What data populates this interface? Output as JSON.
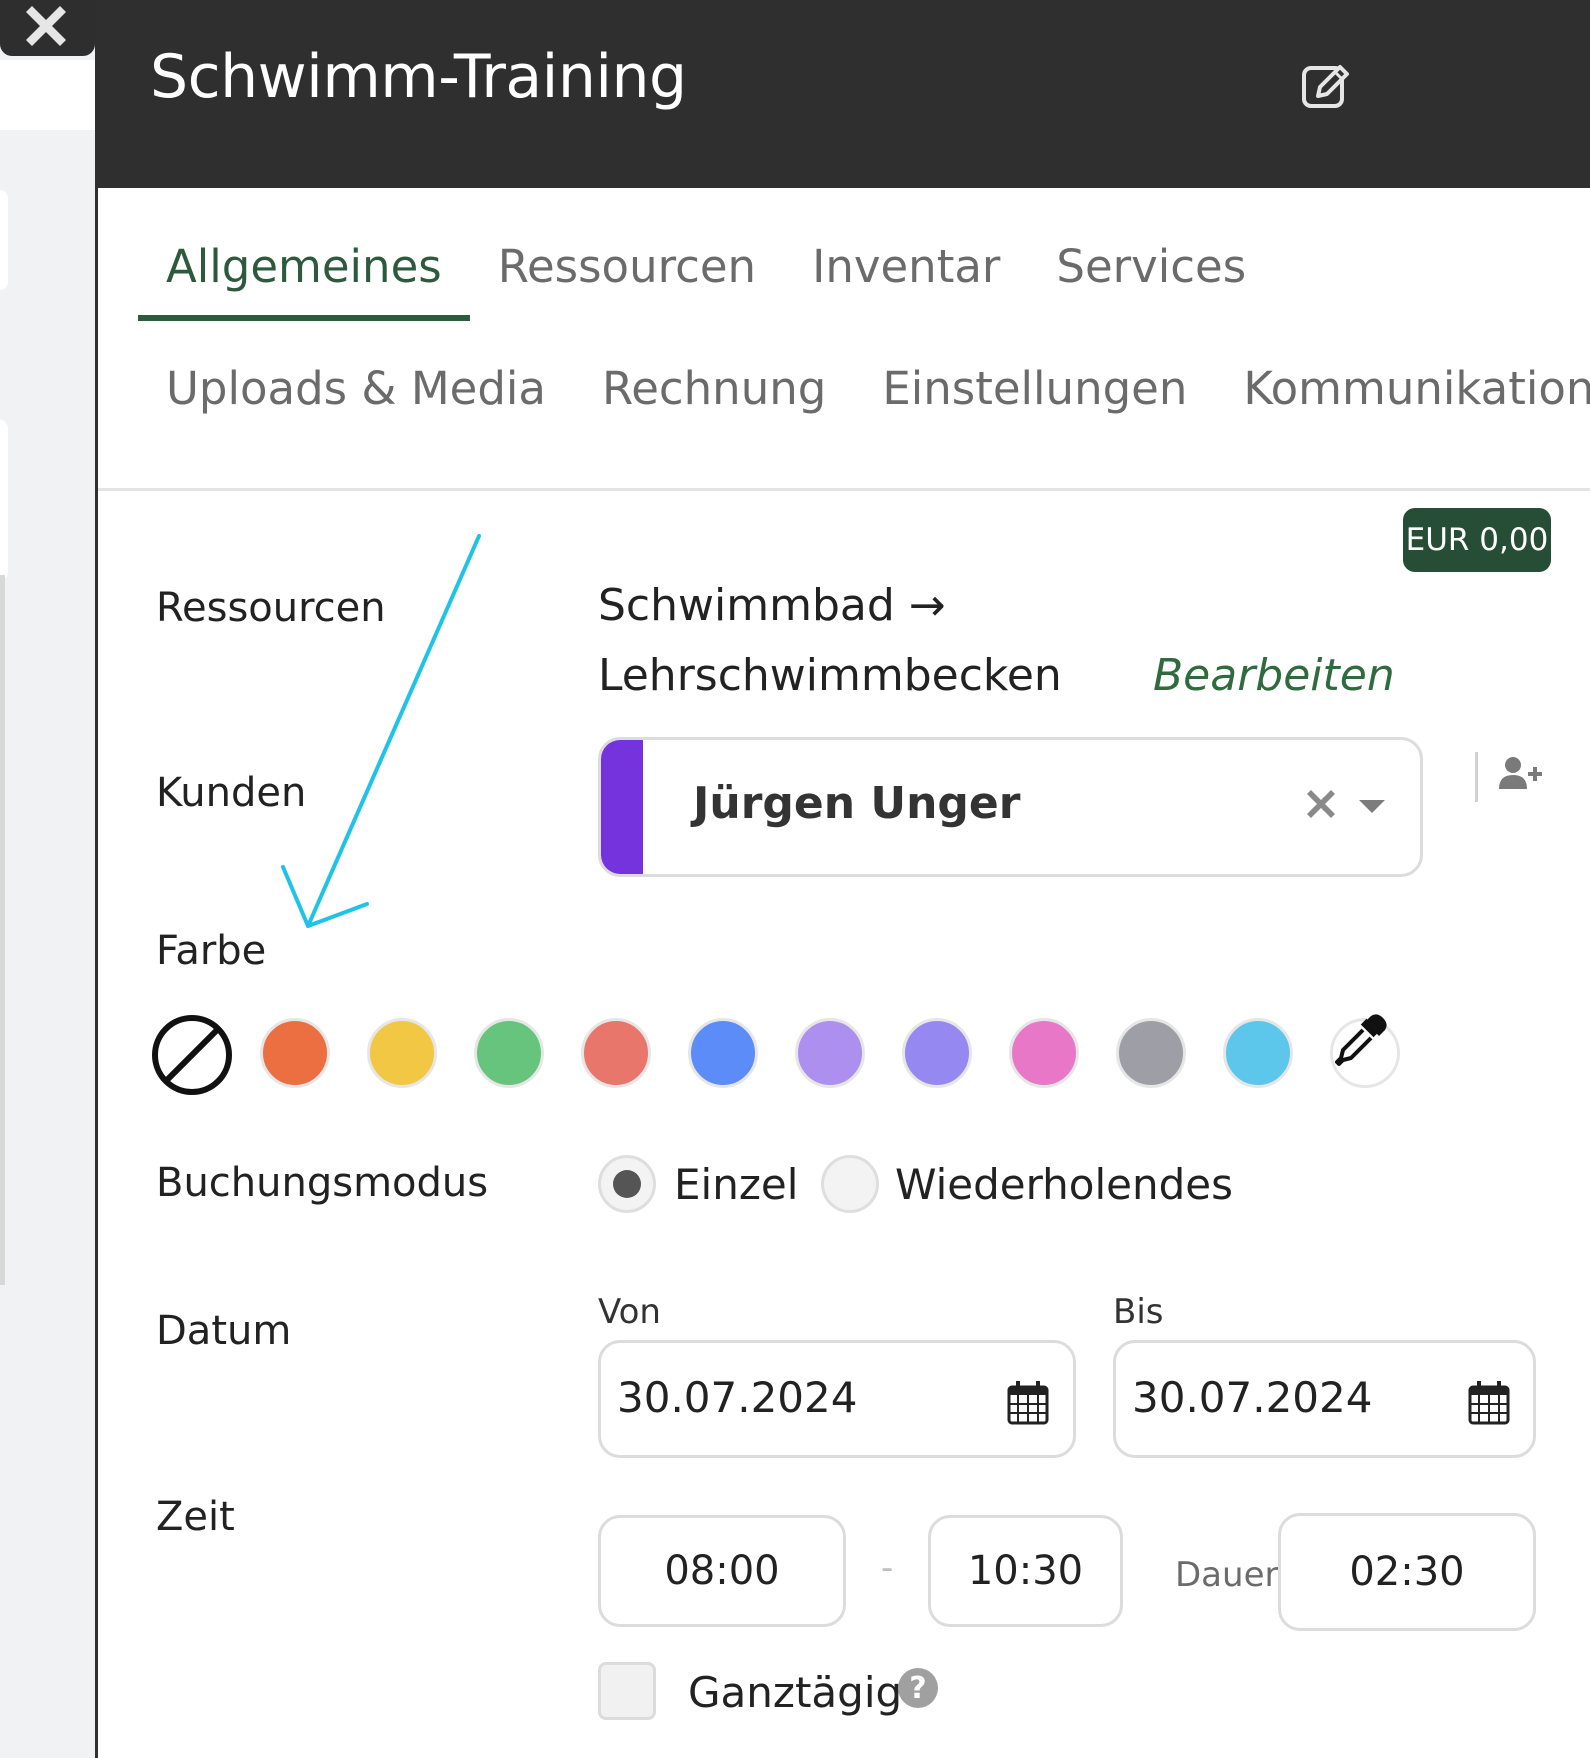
{
  "modal": {
    "title": "Schwimm-Training",
    "tabs_row1": [
      "Allgemeines",
      "Ressourcen",
      "Inventar",
      "Services"
    ],
    "tabs_row2": [
      "Uploads & Media",
      "Rechnung",
      "Einstellungen",
      "Kommunikation"
    ],
    "active_tab": "Allgemeines",
    "price_badge": "EUR 0,00"
  },
  "form": {
    "ressourcen": {
      "label": "Ressourcen",
      "line1": "Schwimmbad →",
      "line2": "Lehrschwimmbecken",
      "edit_link": "Bearbeiten"
    },
    "kunden": {
      "label": "Kunden",
      "selected": "Jürgen Unger",
      "customer_color": "#7433dc"
    },
    "farbe": {
      "label": "Farbe",
      "swatches": [
        "none",
        "#ec6f41",
        "#f2c744",
        "#67c47d",
        "#e8766a",
        "#5b8cf7",
        "#ad8ff0",
        "#9589f1",
        "#e877c8",
        "#9e9ea6",
        "#5cc7ea",
        "#ffffff"
      ],
      "picker_icon": "eyedropper-icon"
    },
    "buchungsmodus": {
      "label": "Buchungsmodus",
      "options": [
        "Einzel",
        "Wiederholendes"
      ],
      "selected": "Einzel"
    },
    "datum": {
      "label": "Datum",
      "von_label": "Von",
      "von_value": "30.07.2024",
      "bis_label": "Bis",
      "bis_value": "30.07.2024"
    },
    "zeit": {
      "label": "Zeit",
      "start": "08:00",
      "separator": "-",
      "end": "10:30",
      "dauer_label": "Dauer",
      "dauer_value": "02:30"
    },
    "ganztaegig": {
      "label": "Ganztägig",
      "checked": false,
      "help": "?"
    }
  },
  "colors": {
    "header_bg": "#2f2f2f",
    "accent_green": "#2d5a3d",
    "badge_bg": "#264d36",
    "annotation_arrow": "#1fc3e8"
  }
}
